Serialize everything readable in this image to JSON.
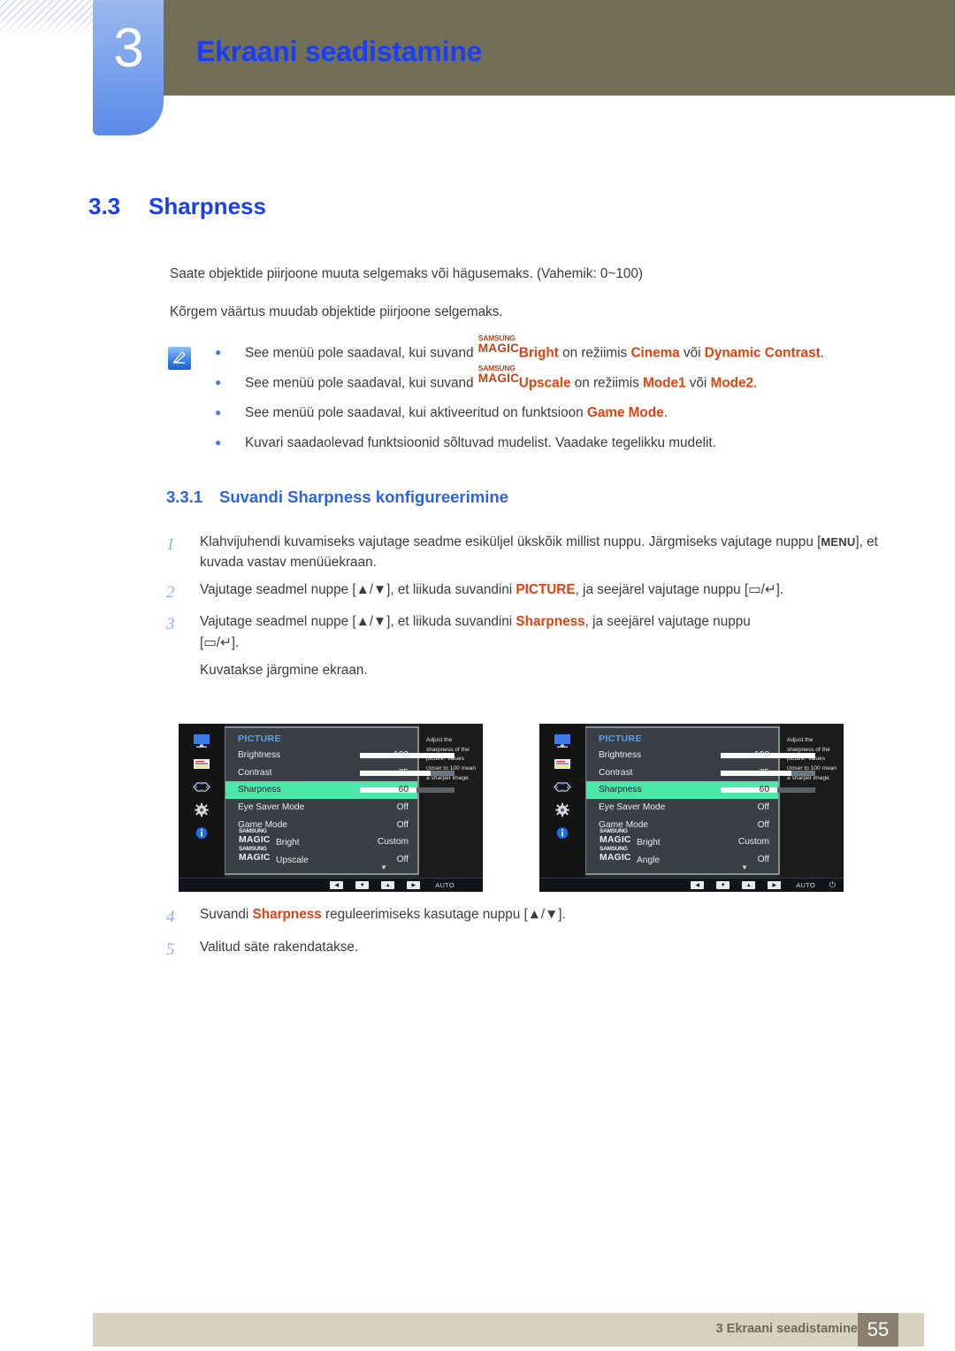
{
  "chapter": {
    "number": "3",
    "title": "Ekraani seadistamine"
  },
  "section": {
    "number": "3.3",
    "title": "Sharpness"
  },
  "paragraphs": [
    "Saate objektide piirjoone muuta selgemaks või hägusemaks. (Vahemik: 0~100)",
    "Kõrgem väärtus muudab objektide piirjoone selgemaks."
  ],
  "note": {
    "icon": "note-pencil-icon",
    "bullet": "●",
    "items": [
      {
        "pre": "See menüü pole saadaval, kui suvand ",
        "magic_top": "SAMSUNG",
        "magic_bottom": "MAGIC",
        "magic_suffix": "Bright",
        "mid": " on režiimis ",
        "opt1": "Cinema",
        "conj": " või ",
        "opt2": "Dynamic Contrast",
        "post": "."
      },
      {
        "pre": "See menüü pole saadaval, kui suvand ",
        "magic_top": "SAMSUNG",
        "magic_bottom": "MAGIC",
        "magic_suffix": "Upscale",
        "mid": " on režiimis ",
        "opt1": "Mode1",
        "conj": " või ",
        "opt2": "Mode2",
        "post": "."
      },
      {
        "pre": "See menüü pole saadaval, kui aktiveeritud on funktsioon ",
        "opt1": "Game Mode",
        "post": "."
      },
      {
        "pre": "Kuvari saadaolevad funktsioonid sõltuvad mudelist. Vaadake tegelikku mudelit."
      }
    ]
  },
  "subsection": {
    "number": "3.3.1",
    "title": "Suvandi Sharpness konfigureerimine"
  },
  "steps": [
    {
      "n": "1",
      "a": "Klahvijuhendi kuvamiseks vajutage seadme esiküljel ükskõik millist nuppu. Järgmiseks vajutage nuppu [",
      "kbd": "MENU",
      "b": "], et kuvada vastav menüüekraan."
    },
    {
      "n": "2",
      "a": "Vajutage seadmel nuppe [▲/▼], et liikuda suvandini ",
      "hl": "PICTURE",
      "b": ", ja seejärel vajutage nuppu [▭/↵]."
    },
    {
      "n": "3",
      "a": "Vajutage seadmel nuppe [▲/▼], et liikuda suvandini ",
      "hl": "Sharpness",
      "b": ", ja seejärel vajutage nuppu",
      "line2": "[▭/↵].",
      "sub": "Kuvatakse järgmine ekraan."
    },
    {
      "n": "4",
      "a": "Suvandi ",
      "hl": "Sharpness",
      "b": " reguleerimiseks kasutage nuppu [▲/▼]."
    },
    {
      "n": "5",
      "a": "Valitud säte rakendatakse."
    }
  ],
  "osd": {
    "title": "PICTURE",
    "help_text": "Adjust the sharpness of the picture. Values closer to 100 mean a sharper image.",
    "rail_icons": [
      "monitor-icon",
      "list-icon",
      "dpad-icon",
      "gear-icon",
      "info-icon"
    ],
    "footer": {
      "left_label": "◀",
      "down_label": "▼",
      "up_label": "▲",
      "right_label": "▶",
      "auto_label": "AUTO",
      "power_label": "⏻"
    },
    "caret": "▼",
    "highlight_color": "#4ce8a9",
    "left": {
      "rows": [
        {
          "label": "Brightness",
          "bar": 100,
          "value": "100"
        },
        {
          "label": "Contrast",
          "bar": 75,
          "value": "75"
        },
        {
          "label": "Sharpness",
          "bar": 60,
          "value": "60",
          "highlight": true
        },
        {
          "label": "Eye Saver Mode",
          "value": "Off"
        },
        {
          "label": "Game Mode",
          "value": "Off"
        },
        {
          "magic_top": "SAMSUNG",
          "magic_bottom": "MAGIC",
          "label": "Bright",
          "value": "Custom"
        },
        {
          "magic_top": "SAMSUNG",
          "magic_bottom": "MAGIC",
          "label": "Upscale",
          "value": "Off"
        }
      ]
    },
    "right": {
      "rows": [
        {
          "label": "Brightness",
          "bar": 100,
          "value": "100"
        },
        {
          "label": "Contrast",
          "bar": 75,
          "value": "75"
        },
        {
          "label": "Sharpness",
          "bar": 60,
          "value": "60",
          "highlight": true
        },
        {
          "label": "Eye Saver Mode",
          "value": "Off"
        },
        {
          "label": "Game Mode",
          "value": "Off"
        },
        {
          "magic_top": "SAMSUNG",
          "magic_bottom": "MAGIC",
          "label": "Bright",
          "value": "Custom"
        },
        {
          "magic_top": "SAMSUNG",
          "magic_bottom": "MAGIC",
          "label": "Angle",
          "value": "Off"
        }
      ]
    }
  },
  "footer": {
    "text": "3 Ekraani seadistamine",
    "page": "55"
  }
}
